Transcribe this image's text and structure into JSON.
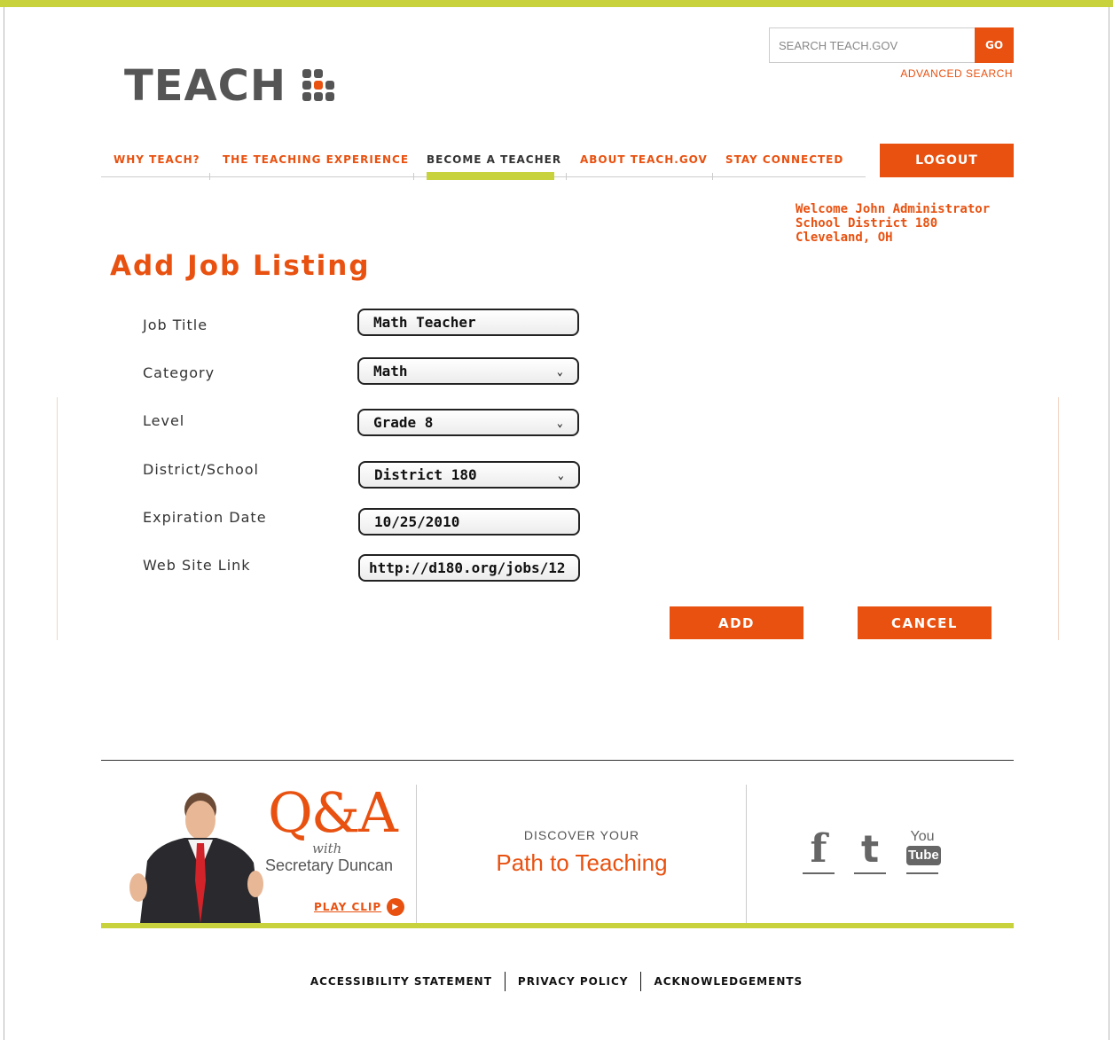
{
  "brand": {
    "logo_text": "TEACH",
    "accent": "#e85110",
    "green": "#c8d23c"
  },
  "search": {
    "placeholder": "SEARCH TEACH.GOV",
    "go_label": "GO",
    "advanced_label": "ADVANCED SEARCH"
  },
  "nav": {
    "items": [
      {
        "label": "WHY TEACH?"
      },
      {
        "label": "THE TEACHING EXPERIENCE"
      },
      {
        "label": "BECOME A TEACHER",
        "active": true
      },
      {
        "label": "ABOUT TEACH.GOV"
      },
      {
        "label": "STAY CONNECTED"
      }
    ],
    "logout_label": "LOGOUT"
  },
  "welcome": {
    "line1": "Welcome John Administrator",
    "line2": "School District 180",
    "line3": "Cleveland, OH"
  },
  "page": {
    "title": "Add Job Listing"
  },
  "form": {
    "job_title": {
      "label": "Job Title",
      "value": "Math Teacher"
    },
    "category": {
      "label": "Category",
      "value": "Math"
    },
    "level": {
      "label": "Level",
      "value": "Grade 8"
    },
    "district": {
      "label": "District/School",
      "value": "District 180"
    },
    "expiration": {
      "label": "Expiration Date",
      "value": "10/25/2010"
    },
    "website": {
      "label": "Web Site Link",
      "value": "http://d180.org/jobs/12"
    },
    "add_label": "ADD",
    "cancel_label": "CANCEL"
  },
  "footer": {
    "qa": {
      "title": "Q&A",
      "with": "with",
      "name": "Secretary Duncan",
      "play_label": "PLAY CLIP"
    },
    "discover": {
      "line1": "DISCOVER YOUR",
      "line2": "Path to Teaching"
    },
    "social": [
      {
        "icon": "facebook-icon",
        "glyph": "f"
      },
      {
        "icon": "twitter-icon",
        "glyph": "t"
      },
      {
        "icon": "youtube-icon",
        "top": "You",
        "bottom": "Tube"
      }
    ],
    "links": [
      {
        "label": "ACCESSIBILITY STATEMENT"
      },
      {
        "label": "PRIVACY POLICY"
      },
      {
        "label": "ACKNOWLEDGEMENTS"
      }
    ]
  }
}
